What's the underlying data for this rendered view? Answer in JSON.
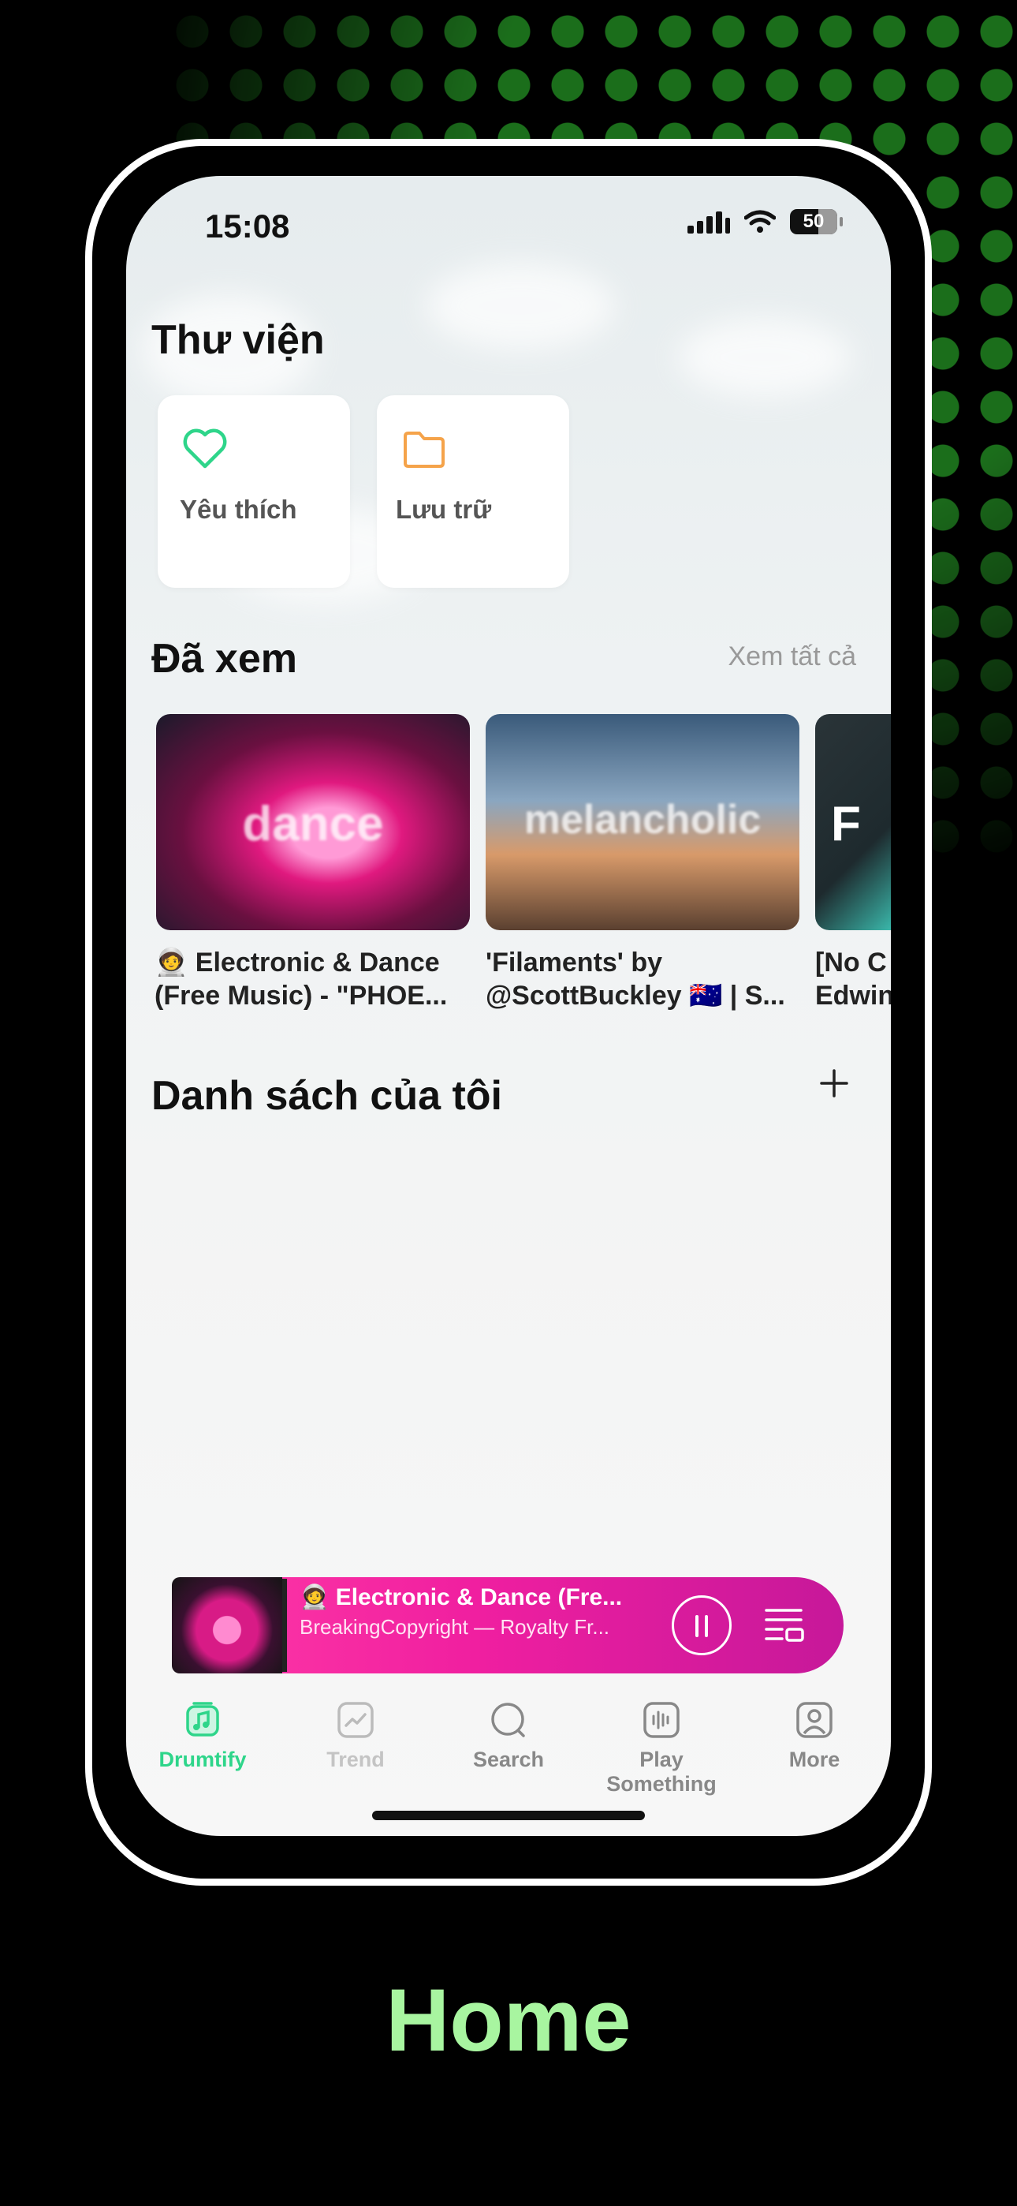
{
  "status_bar": {
    "time": "15:08",
    "battery": "50"
  },
  "library": {
    "title": "Thư viện",
    "cards": [
      {
        "label": "Yêu thích",
        "icon": "heart-icon",
        "color": "#2ed58a"
      },
      {
        "label": "Lưu trữ",
        "icon": "folder-icon",
        "color": "#f5a34a"
      }
    ]
  },
  "watched": {
    "title": "Đã xem",
    "see_all": "Xem tất cả",
    "items": [
      {
        "thumb_text": "dance",
        "line1": "🧑‍🚀 Electronic & Dance",
        "line2": "(Free Music) - \"PHOE..."
      },
      {
        "thumb_text": "melancholic",
        "line1": "'Filaments' by",
        "line2": "@ScottBuckley  🇦🇺 | S..."
      },
      {
        "thumb_text": "F",
        "line1": "[No C",
        "line2": "Edwin"
      }
    ]
  },
  "my_playlists": {
    "title": "Danh sách của tôi"
  },
  "mini_player": {
    "title": "🧑‍🚀 Electronic & Dance (Fre...",
    "subtitle": "BreakingCopyright — Royalty Fr..."
  },
  "tabs": [
    {
      "label": "Drumtify",
      "icon": "music-note-icon",
      "active": true
    },
    {
      "label": "Trend",
      "icon": "trend-icon",
      "active": false
    },
    {
      "label": "Search",
      "icon": "search-icon",
      "active": false
    },
    {
      "label": "Play Something",
      "icon": "waveform-icon",
      "active": false
    },
    {
      "label": "More",
      "icon": "profile-icon",
      "active": false
    }
  ],
  "caption": "Home",
  "colors": {
    "accent": "#2ed58a",
    "player": "#f01fa0",
    "caption": "#a8f5a0"
  }
}
